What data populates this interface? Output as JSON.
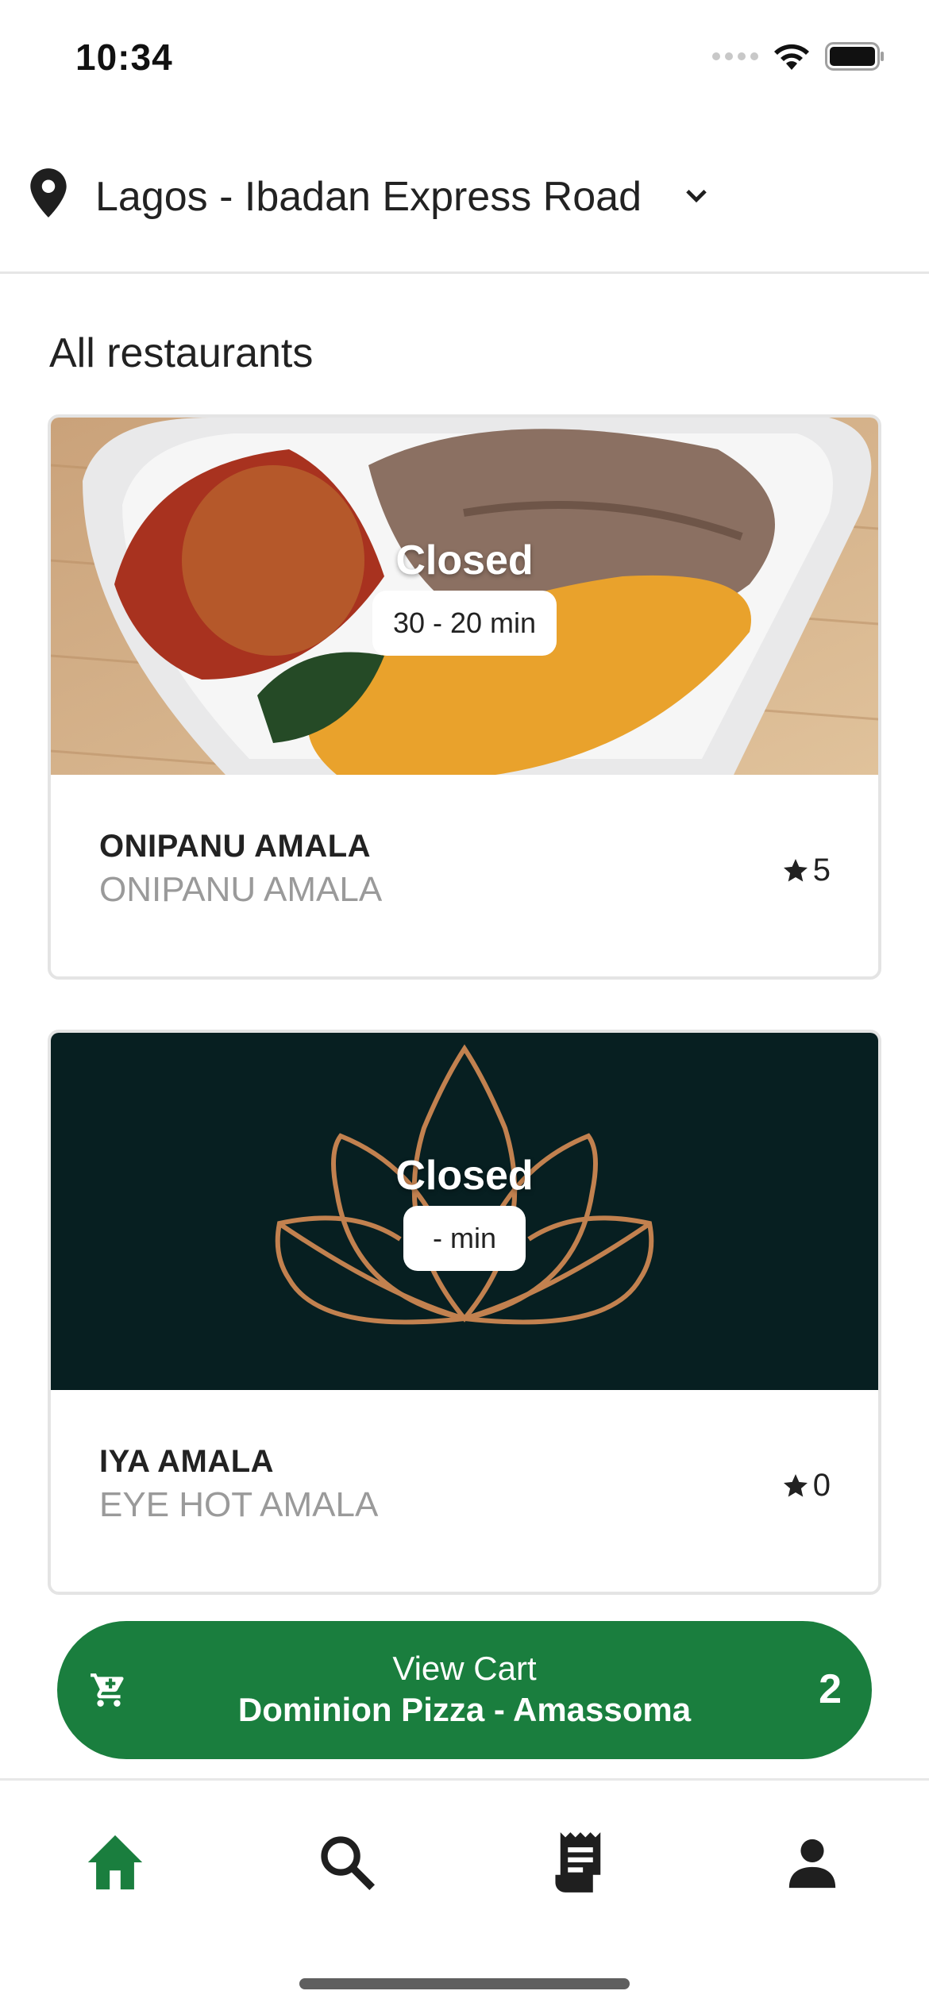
{
  "status_bar": {
    "time": "10:34"
  },
  "location": {
    "name": "Lagos - Ibadan Express Road",
    "icon": "map-pin-icon",
    "dropdown_icon": "chevron-down-icon"
  },
  "section": {
    "title": "All restaurants"
  },
  "restaurants": [
    {
      "status": "Closed",
      "delivery_time": "30 - 20 min",
      "name": "ONIPANU AMALA",
      "subtitle": "ONIPANU AMALA",
      "rating": "5",
      "image": "amala-dish-photo"
    },
    {
      "status": "Closed",
      "delivery_time": "-  min",
      "name": "IYA AMALA",
      "subtitle": "EYE HOT AMALA",
      "rating": "0",
      "image": "lotus-logo"
    }
  ],
  "cart": {
    "title": "View Cart",
    "store": "Dominion Pizza - Amassoma",
    "count": "2",
    "icon": "cart-icon"
  },
  "tabs": [
    {
      "name": "home",
      "icon": "home-icon",
      "active": true
    },
    {
      "name": "search",
      "icon": "search-icon",
      "active": false
    },
    {
      "name": "orders",
      "icon": "receipt-icon",
      "active": false
    },
    {
      "name": "profile",
      "icon": "person-icon",
      "active": false
    }
  ],
  "colors": {
    "accent": "#1a7e3e",
    "text": "#222222",
    "muted": "#9a9a9a",
    "logo_bg": "#071f21",
    "logo_stroke": "#c2814f"
  }
}
